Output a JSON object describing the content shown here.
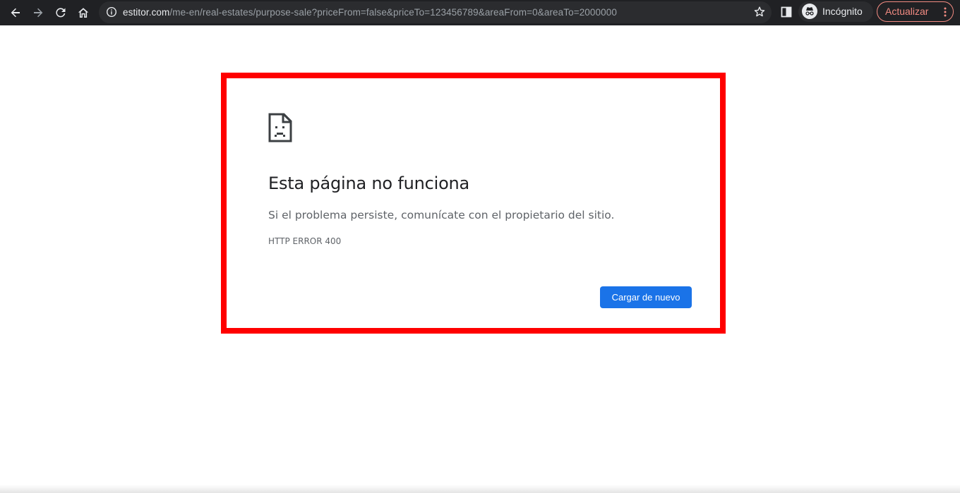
{
  "browser": {
    "url_host": "estitor.com",
    "url_path": "/me-en/real-estates/purpose-sale?priceFrom=false&priceTo=123456789&areaFrom=0&areaTo=2000000",
    "incognito_label": "Incógnito",
    "update_label": "Actualizar",
    "icons": {
      "back": "arrow-left-icon",
      "forward": "arrow-right-icon",
      "reload": "reload-icon",
      "home": "home-icon",
      "info": "info-icon",
      "star": "star-icon",
      "side_panel": "side-panel-icon",
      "incognito": "incognito-icon",
      "menu": "kebab-menu-icon"
    },
    "colors": {
      "toolbar_bg": "#202124",
      "update_accent": "#f28b82"
    }
  },
  "error_page": {
    "title": "Esta página no funciona",
    "description": "Si el problema persiste, comunícate con el propietario del sitio.",
    "error_code": "HTTP ERROR 400",
    "reload_label": "Cargar de nuevo",
    "icon": "sad-page-icon",
    "colors": {
      "button": "#1a73e8",
      "highlight_border": "#ff0000"
    }
  }
}
